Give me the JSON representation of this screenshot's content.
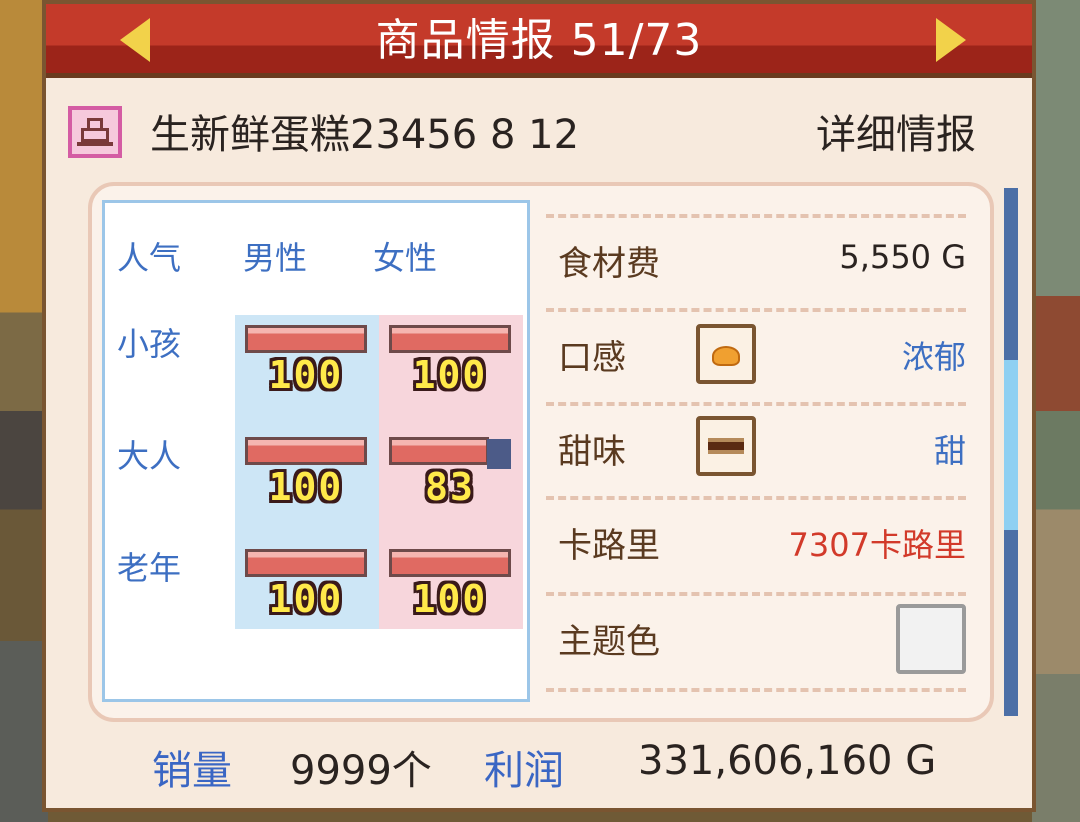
{
  "header": {
    "title": "商品情报 51/73"
  },
  "product": {
    "name": "生新鲜蛋糕23456 8 12",
    "detail_link": "详细情报",
    "icon": "cake-icon"
  },
  "popularity": {
    "corner_label": "人气",
    "col_male": "男性",
    "col_female": "女性",
    "rows": [
      {
        "label": "小孩",
        "male": "100",
        "female": "100"
      },
      {
        "label": "大人",
        "male": "100",
        "female": "83"
      },
      {
        "label": "老年",
        "male": "100",
        "female": "100"
      }
    ]
  },
  "stats": {
    "cost_label": "食材费",
    "cost_value": "5,550 G",
    "texture_label": "口感",
    "texture_value": "浓郁",
    "sweet_label": "甜味",
    "sweet_value": "甜",
    "calorie_label": "卡路里",
    "calorie_value": "7307卡路里",
    "theme_label": "主题色",
    "calorie_color": "#d23a2a",
    "value_color": "#3d6fc2"
  },
  "footer": {
    "sales_label": "销量",
    "sales_value": "9999个",
    "profit_label": "利润",
    "profit_value": "331,606,160 G"
  }
}
